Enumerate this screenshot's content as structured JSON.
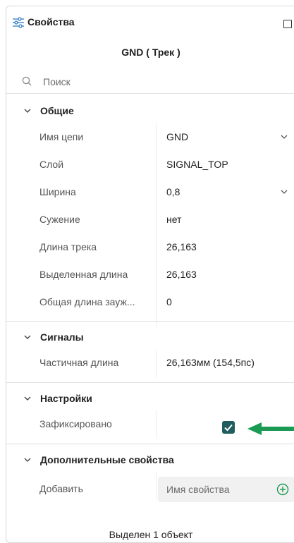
{
  "header": {
    "title": "Свойства",
    "title_icon": "sliders-icon",
    "maximize_icon": "square-icon"
  },
  "object_name": "GND ( Трек )",
  "search": {
    "placeholder": "Поиск",
    "icon": "search-icon"
  },
  "sections": [
    {
      "title": "Общие",
      "rows": [
        {
          "label": "Имя цепи",
          "value": "GND",
          "dropdown": true
        },
        {
          "label": "Слой",
          "value": "SIGNAL_TOP",
          "dropdown": false
        },
        {
          "label": "Ширина",
          "value": "0,8",
          "dropdown": true
        },
        {
          "label": "Сужение",
          "value": "нет",
          "dropdown": false
        },
        {
          "label": "Длина трека",
          "value": "26,163",
          "dropdown": false
        },
        {
          "label": "Выделенная длина",
          "value": "26,163",
          "dropdown": false
        },
        {
          "label": "Общая длина зауж...",
          "value": "0",
          "dropdown": false
        }
      ]
    },
    {
      "title": "Сигналы",
      "rows": [
        {
          "label": "Частичная длина",
          "value": "26,163мм (154,5пс)",
          "dropdown": false
        }
      ]
    },
    {
      "title": "Настройки",
      "rows": [
        {
          "label": "Зафиксировано",
          "checked": true
        }
      ]
    },
    {
      "title": "Дополнительные свойства",
      "rows": [
        {
          "label": "Добавить",
          "input_placeholder": "Имя свойства",
          "action_icon": "plus-circle-icon"
        }
      ]
    }
  ],
  "annotation": {
    "icon": "arrow-left-icon",
    "color": "#1a9a52"
  },
  "footer": "Выделен 1 объект",
  "colors": {
    "checkbox": "#1f5d5e",
    "accent": "#1a9a52"
  }
}
